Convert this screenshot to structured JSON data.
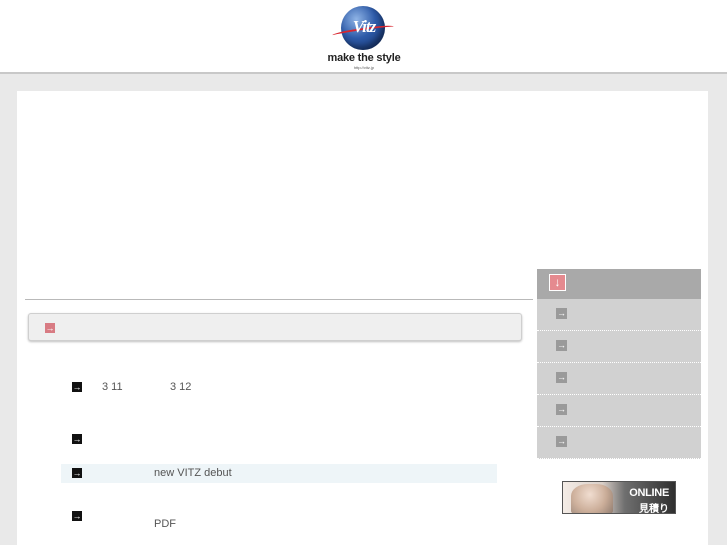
{
  "header": {
    "logo_mark": "Vitz",
    "tagline": "make the style",
    "url": "http://vitz.jp"
  },
  "news": {
    "items": [
      {
        "parts": [
          "3 11",
          "3 12"
        ]
      },
      {
        "parts": []
      },
      {
        "parts": [
          "new VITZ debut"
        ]
      },
      {
        "parts": [
          "PDF"
        ]
      }
    ]
  },
  "banner": {
    "line1": "ONLINE",
    "line2": "見積り"
  },
  "colors": {
    "accent_red": "#d87b83",
    "menu_grey": "#d1d1d1",
    "menu_head": "#a9a9a9",
    "highlight_row": "#eef5f8"
  },
  "icons": {
    "section_marker": "arrow-right-icon",
    "news_marker": "arrow-right-icon",
    "menu_head": "arrow-down-icon",
    "menu_item": "arrow-right-icon"
  }
}
